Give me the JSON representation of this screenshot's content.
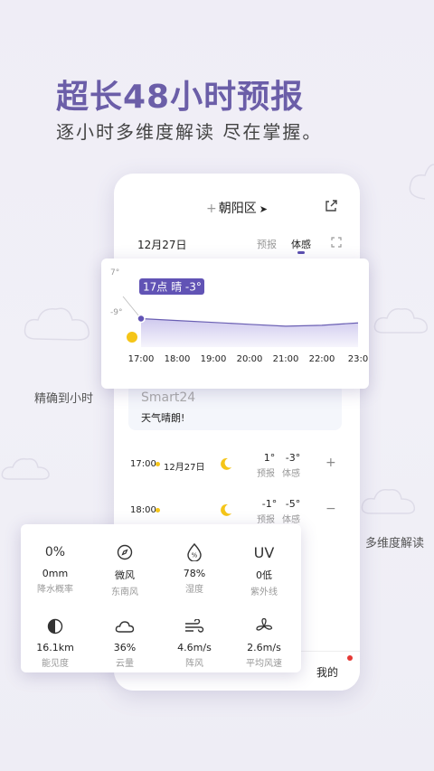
{
  "promo": {
    "headline": "超长48小时预报",
    "subline": "逐小时多维度解读  尽在掌握。",
    "label_hourly": "精确到小时",
    "label_multi": "多维度解读"
  },
  "header": {
    "location": "朝阳区",
    "date": "12月27日",
    "tab_forecast": "预报",
    "tab_feel": "体感"
  },
  "chart_data": {
    "type": "area",
    "x": [
      "17:00",
      "18:00",
      "19:00",
      "20:00",
      "21:00",
      "22:00",
      "23:00"
    ],
    "series": [
      {
        "values": [
          -3.0,
          -3.4,
          -3.8,
          -4.2,
          -4.6,
          -4.4,
          -3.9
        ]
      }
    ],
    "y_ticks": [
      "7°",
      "-9°"
    ],
    "ylim": [
      -9,
      7
    ],
    "tooltip": "17点 晴 -3°",
    "x_tick_labels": [
      "17:00",
      "18:00",
      "19:00",
      "20:00",
      "21:00",
      "22:00",
      "23:0"
    ],
    "colors": {
      "line": "#6a5fb3",
      "fill_top": "#cfc9ee",
      "fill_bottom": "#f6f5fc",
      "tooltip_bg": "#6153b5",
      "point": "#6153b5"
    }
  },
  "smart": {
    "title": "Smart24",
    "text": "天气晴朗!"
  },
  "hours": [
    {
      "time": "17:00",
      "date": "12月27日",
      "temp_forecast": "1°",
      "temp_feel": "-3°",
      "label_forecast": "预报",
      "label_feel": "体感",
      "toggle": "+",
      "icon": "moon-icon"
    },
    {
      "time": "18:00",
      "date": "",
      "temp_forecast": "-1°",
      "temp_feel": "-5°",
      "label_forecast": "预报",
      "label_feel": "体感",
      "toggle": "−",
      "icon": "moon-icon"
    }
  ],
  "metrics": [
    {
      "icon": "percent-text-icon",
      "icon_text": "0%",
      "value": "0mm",
      "label": "降水概率"
    },
    {
      "icon": "compass-icon",
      "icon_text": "",
      "value": "微风",
      "label": "东南风"
    },
    {
      "icon": "humidity-icon",
      "icon_text": "",
      "value": "78%",
      "label": "湿度"
    },
    {
      "icon": "uv-text-icon",
      "icon_text": "UV",
      "value": "0低",
      "label": "紫外线"
    },
    {
      "icon": "visibility-icon",
      "icon_text": "",
      "value": "16.1km",
      "label": "能见度"
    },
    {
      "icon": "cloud-icon",
      "icon_text": "",
      "value": "36%",
      "label": "云量"
    },
    {
      "icon": "wind-gust-icon",
      "icon_text": "",
      "value": "4.6m/s",
      "label": "阵风"
    },
    {
      "icon": "fan-icon",
      "icon_text": "",
      "value": "2.6m/s",
      "label": "平均风速"
    }
  ],
  "bottom": {
    "mine": "我的"
  },
  "colors": {
    "accent": "#6b5ea8",
    "sun": "#f5c518",
    "notify": "#e53935"
  }
}
